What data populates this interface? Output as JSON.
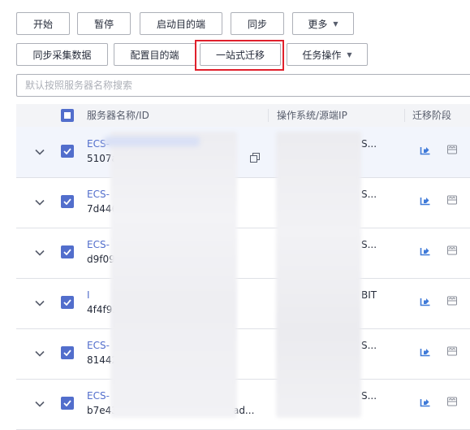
{
  "toolbar": {
    "row1": [
      "开始",
      "暂停",
      "启动目的端",
      "同步",
      "更多"
    ],
    "row2": [
      "同步采集数据",
      "配置目的端",
      "一站式迁移",
      "任务操作"
    ]
  },
  "search": {
    "placeholder": "默认按照服务器名称搜索"
  },
  "table": {
    "headers": {
      "name": "服务器名称/ID",
      "os": "操作系统/源端IP",
      "stage": "迁移阶段"
    },
    "rows": [
      {
        "name": "ECS-",
        "id": "5107a",
        "os": "S..."
      },
      {
        "name": "ECS-",
        "id": "7d446",
        "os": "S..."
      },
      {
        "name": "ECS-",
        "id": "d9f09",
        "os": "S..."
      },
      {
        "name": "I",
        "id": "4f4f93",
        "os": "BIT"
      },
      {
        "name": "ECS-",
        "id": "81442",
        "os": "S..."
      },
      {
        "name": "ECS-",
        "id": "b7e43dfb-e00d-499d-902c-3aad...",
        "os": "S..."
      }
    ]
  },
  "colors": {
    "accent": "#526ecc",
    "highlight": "#e0202c"
  },
  "icons": [
    "chevron-down-icon",
    "checkbox-checked-icon",
    "copy-icon",
    "migrate-icon",
    "server-icon"
  ]
}
